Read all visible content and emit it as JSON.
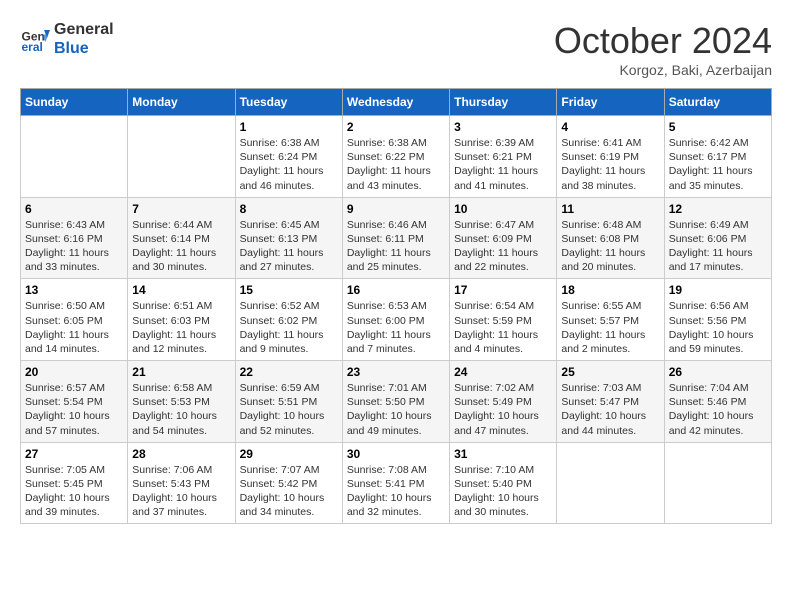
{
  "header": {
    "logo_line1": "General",
    "logo_line2": "Blue",
    "title": "October 2024",
    "location": "Korgoz, Baki, Azerbaijan"
  },
  "columns": [
    "Sunday",
    "Monday",
    "Tuesday",
    "Wednesday",
    "Thursday",
    "Friday",
    "Saturday"
  ],
  "weeks": [
    [
      {
        "day": "",
        "content": ""
      },
      {
        "day": "",
        "content": ""
      },
      {
        "day": "1",
        "content": "Sunrise: 6:38 AM\nSunset: 6:24 PM\nDaylight: 11 hours and 46 minutes."
      },
      {
        "day": "2",
        "content": "Sunrise: 6:38 AM\nSunset: 6:22 PM\nDaylight: 11 hours and 43 minutes."
      },
      {
        "day": "3",
        "content": "Sunrise: 6:39 AM\nSunset: 6:21 PM\nDaylight: 11 hours and 41 minutes."
      },
      {
        "day": "4",
        "content": "Sunrise: 6:41 AM\nSunset: 6:19 PM\nDaylight: 11 hours and 38 minutes."
      },
      {
        "day": "5",
        "content": "Sunrise: 6:42 AM\nSunset: 6:17 PM\nDaylight: 11 hours and 35 minutes."
      }
    ],
    [
      {
        "day": "6",
        "content": "Sunrise: 6:43 AM\nSunset: 6:16 PM\nDaylight: 11 hours and 33 minutes."
      },
      {
        "day": "7",
        "content": "Sunrise: 6:44 AM\nSunset: 6:14 PM\nDaylight: 11 hours and 30 minutes."
      },
      {
        "day": "8",
        "content": "Sunrise: 6:45 AM\nSunset: 6:13 PM\nDaylight: 11 hours and 27 minutes."
      },
      {
        "day": "9",
        "content": "Sunrise: 6:46 AM\nSunset: 6:11 PM\nDaylight: 11 hours and 25 minutes."
      },
      {
        "day": "10",
        "content": "Sunrise: 6:47 AM\nSunset: 6:09 PM\nDaylight: 11 hours and 22 minutes."
      },
      {
        "day": "11",
        "content": "Sunrise: 6:48 AM\nSunset: 6:08 PM\nDaylight: 11 hours and 20 minutes."
      },
      {
        "day": "12",
        "content": "Sunrise: 6:49 AM\nSunset: 6:06 PM\nDaylight: 11 hours and 17 minutes."
      }
    ],
    [
      {
        "day": "13",
        "content": "Sunrise: 6:50 AM\nSunset: 6:05 PM\nDaylight: 11 hours and 14 minutes."
      },
      {
        "day": "14",
        "content": "Sunrise: 6:51 AM\nSunset: 6:03 PM\nDaylight: 11 hours and 12 minutes."
      },
      {
        "day": "15",
        "content": "Sunrise: 6:52 AM\nSunset: 6:02 PM\nDaylight: 11 hours and 9 minutes."
      },
      {
        "day": "16",
        "content": "Sunrise: 6:53 AM\nSunset: 6:00 PM\nDaylight: 11 hours and 7 minutes."
      },
      {
        "day": "17",
        "content": "Sunrise: 6:54 AM\nSunset: 5:59 PM\nDaylight: 11 hours and 4 minutes."
      },
      {
        "day": "18",
        "content": "Sunrise: 6:55 AM\nSunset: 5:57 PM\nDaylight: 11 hours and 2 minutes."
      },
      {
        "day": "19",
        "content": "Sunrise: 6:56 AM\nSunset: 5:56 PM\nDaylight: 10 hours and 59 minutes."
      }
    ],
    [
      {
        "day": "20",
        "content": "Sunrise: 6:57 AM\nSunset: 5:54 PM\nDaylight: 10 hours and 57 minutes."
      },
      {
        "day": "21",
        "content": "Sunrise: 6:58 AM\nSunset: 5:53 PM\nDaylight: 10 hours and 54 minutes."
      },
      {
        "day": "22",
        "content": "Sunrise: 6:59 AM\nSunset: 5:51 PM\nDaylight: 10 hours and 52 minutes."
      },
      {
        "day": "23",
        "content": "Sunrise: 7:01 AM\nSunset: 5:50 PM\nDaylight: 10 hours and 49 minutes."
      },
      {
        "day": "24",
        "content": "Sunrise: 7:02 AM\nSunset: 5:49 PM\nDaylight: 10 hours and 47 minutes."
      },
      {
        "day": "25",
        "content": "Sunrise: 7:03 AM\nSunset: 5:47 PM\nDaylight: 10 hours and 44 minutes."
      },
      {
        "day": "26",
        "content": "Sunrise: 7:04 AM\nSunset: 5:46 PM\nDaylight: 10 hours and 42 minutes."
      }
    ],
    [
      {
        "day": "27",
        "content": "Sunrise: 7:05 AM\nSunset: 5:45 PM\nDaylight: 10 hours and 39 minutes."
      },
      {
        "day": "28",
        "content": "Sunrise: 7:06 AM\nSunset: 5:43 PM\nDaylight: 10 hours and 37 minutes."
      },
      {
        "day": "29",
        "content": "Sunrise: 7:07 AM\nSunset: 5:42 PM\nDaylight: 10 hours and 34 minutes."
      },
      {
        "day": "30",
        "content": "Sunrise: 7:08 AM\nSunset: 5:41 PM\nDaylight: 10 hours and 32 minutes."
      },
      {
        "day": "31",
        "content": "Sunrise: 7:10 AM\nSunset: 5:40 PM\nDaylight: 10 hours and 30 minutes."
      },
      {
        "day": "",
        "content": ""
      },
      {
        "day": "",
        "content": ""
      }
    ]
  ]
}
